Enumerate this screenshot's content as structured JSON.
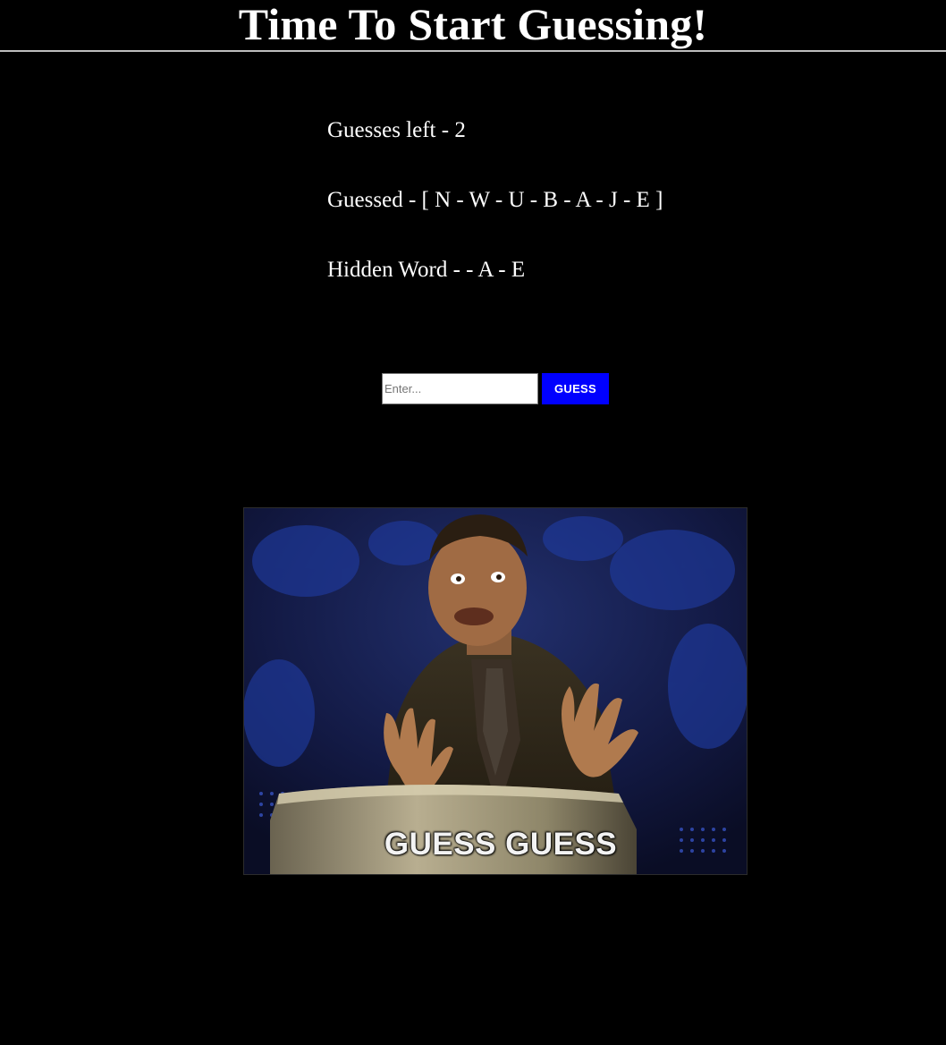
{
  "header": {
    "title": "Time To Start Guessing!"
  },
  "status": {
    "guesses_left": "Guesses left - 2",
    "guessed": "Guessed - [ N - W - U - B - A - J - E ]",
    "hidden_word": "Hidden Word - - A - E"
  },
  "form": {
    "input_placeholder": "Enter...",
    "input_value": "",
    "button_label": "GUESS"
  },
  "gif": {
    "caption": "GUESS GUESS",
    "icon": "animated-gif-image"
  },
  "colors": {
    "background": "#000000",
    "text": "#ffffff",
    "button": "#0000ff",
    "divider": "#bdbdbd"
  }
}
